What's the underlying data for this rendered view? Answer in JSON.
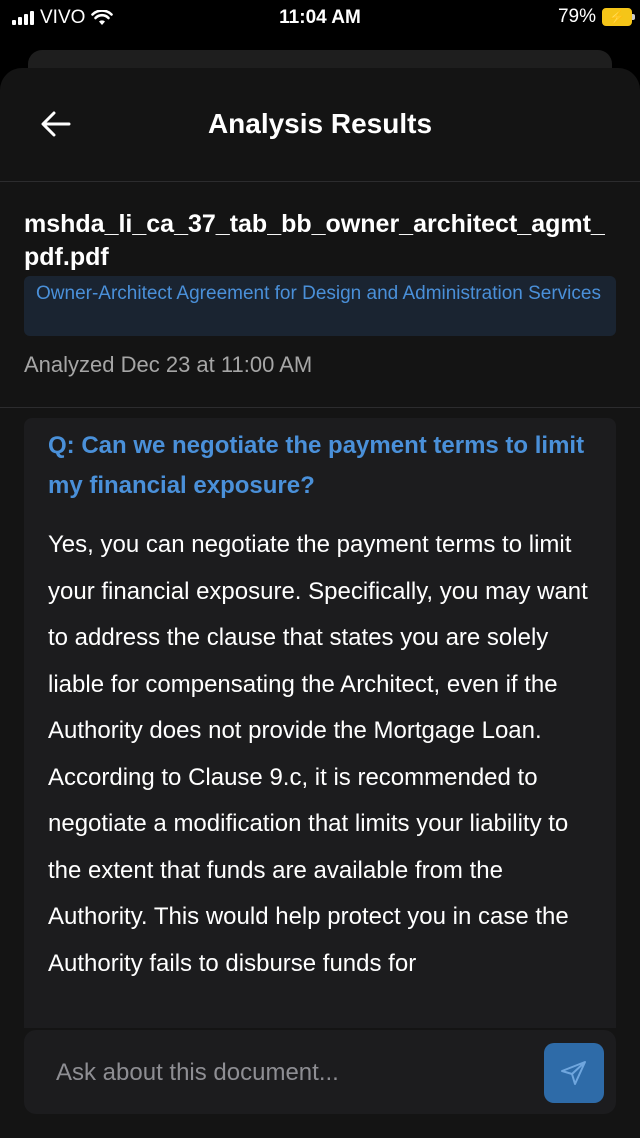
{
  "status_bar": {
    "carrier": "VIVO",
    "time": "11:04 AM",
    "battery_percent": "79%"
  },
  "header": {
    "title": "Analysis Results",
    "back_icon": "arrow-left-icon"
  },
  "document": {
    "file_name": "mshda_li_ca_37_tab_bb_owner_architect_agmt_pdf.pdf",
    "doc_type": "Owner-Architect Agreement for Design and Administration Services",
    "analyzed": "Analyzed Dec 23 at 11:00 AM"
  },
  "qa": {
    "question": "Q: Can we negotiate the payment terms to limit my financial exposure?",
    "answer": "Yes, you can negotiate the payment terms to limit your financial exposure. Specifically, you may want to address the clause that states you are solely liable for compensating the Architect, even if the Authority does not provide the Mortgage Loan. According to Clause 9.c, it is recommended to negotiate a modification that limits your liability to the extent that funds are available from the Authority. This would help protect you in case the Authority fails to disburse funds for"
  },
  "chat_input": {
    "placeholder": "Ask about this document...",
    "send_icon": "send-icon"
  },
  "colors": {
    "accent": "#4a90d9",
    "send_button": "#2e6ba8",
    "background": "#141414"
  }
}
